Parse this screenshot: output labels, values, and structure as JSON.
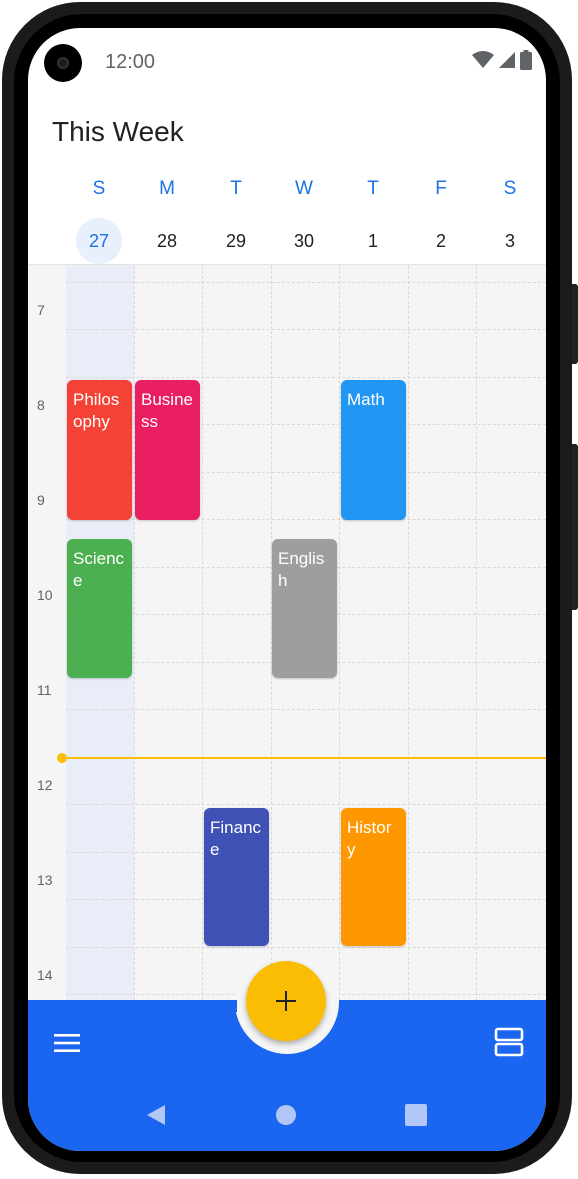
{
  "status_bar": {
    "time": "12:00"
  },
  "header": {
    "title": "This Week"
  },
  "week": {
    "today_index": 0,
    "days": [
      {
        "letter": "S",
        "date": "27"
      },
      {
        "letter": "M",
        "date": "28"
      },
      {
        "letter": "T",
        "date": "29"
      },
      {
        "letter": "W",
        "date": "30"
      },
      {
        "letter": "T",
        "date": "1"
      },
      {
        "letter": "F",
        "date": "2"
      },
      {
        "letter": "S",
        "date": "3"
      }
    ]
  },
  "hours": [
    "7",
    "8",
    "9",
    "10",
    "11",
    "12",
    "13",
    "14"
  ],
  "events": [
    {
      "title": "Philos ophy",
      "color": "#f44336"
    },
    {
      "title": "Busine ss",
      "color": "#e91e63"
    },
    {
      "title": "Math",
      "color": "#2196f3"
    },
    {
      "title": "Scienc e",
      "color": "#4caf50"
    },
    {
      "title": "Englis h",
      "color": "#9e9e9e"
    },
    {
      "title": "Financ e",
      "color": "#3f51b5"
    },
    {
      "title": "Histor y",
      "color": "#ff9800"
    }
  ],
  "colors": {
    "accent": "#1a73e8",
    "bottom_bar": "#1a66f0",
    "fab": "#fbbc04",
    "now_line": "#fbbc04"
  },
  "icons": {
    "fab": "add-icon",
    "menu": "menu-icon",
    "view": "view-agenda-icon",
    "back": "back-triangle-icon",
    "home": "home-circle-icon",
    "recents": "recents-square-icon"
  }
}
